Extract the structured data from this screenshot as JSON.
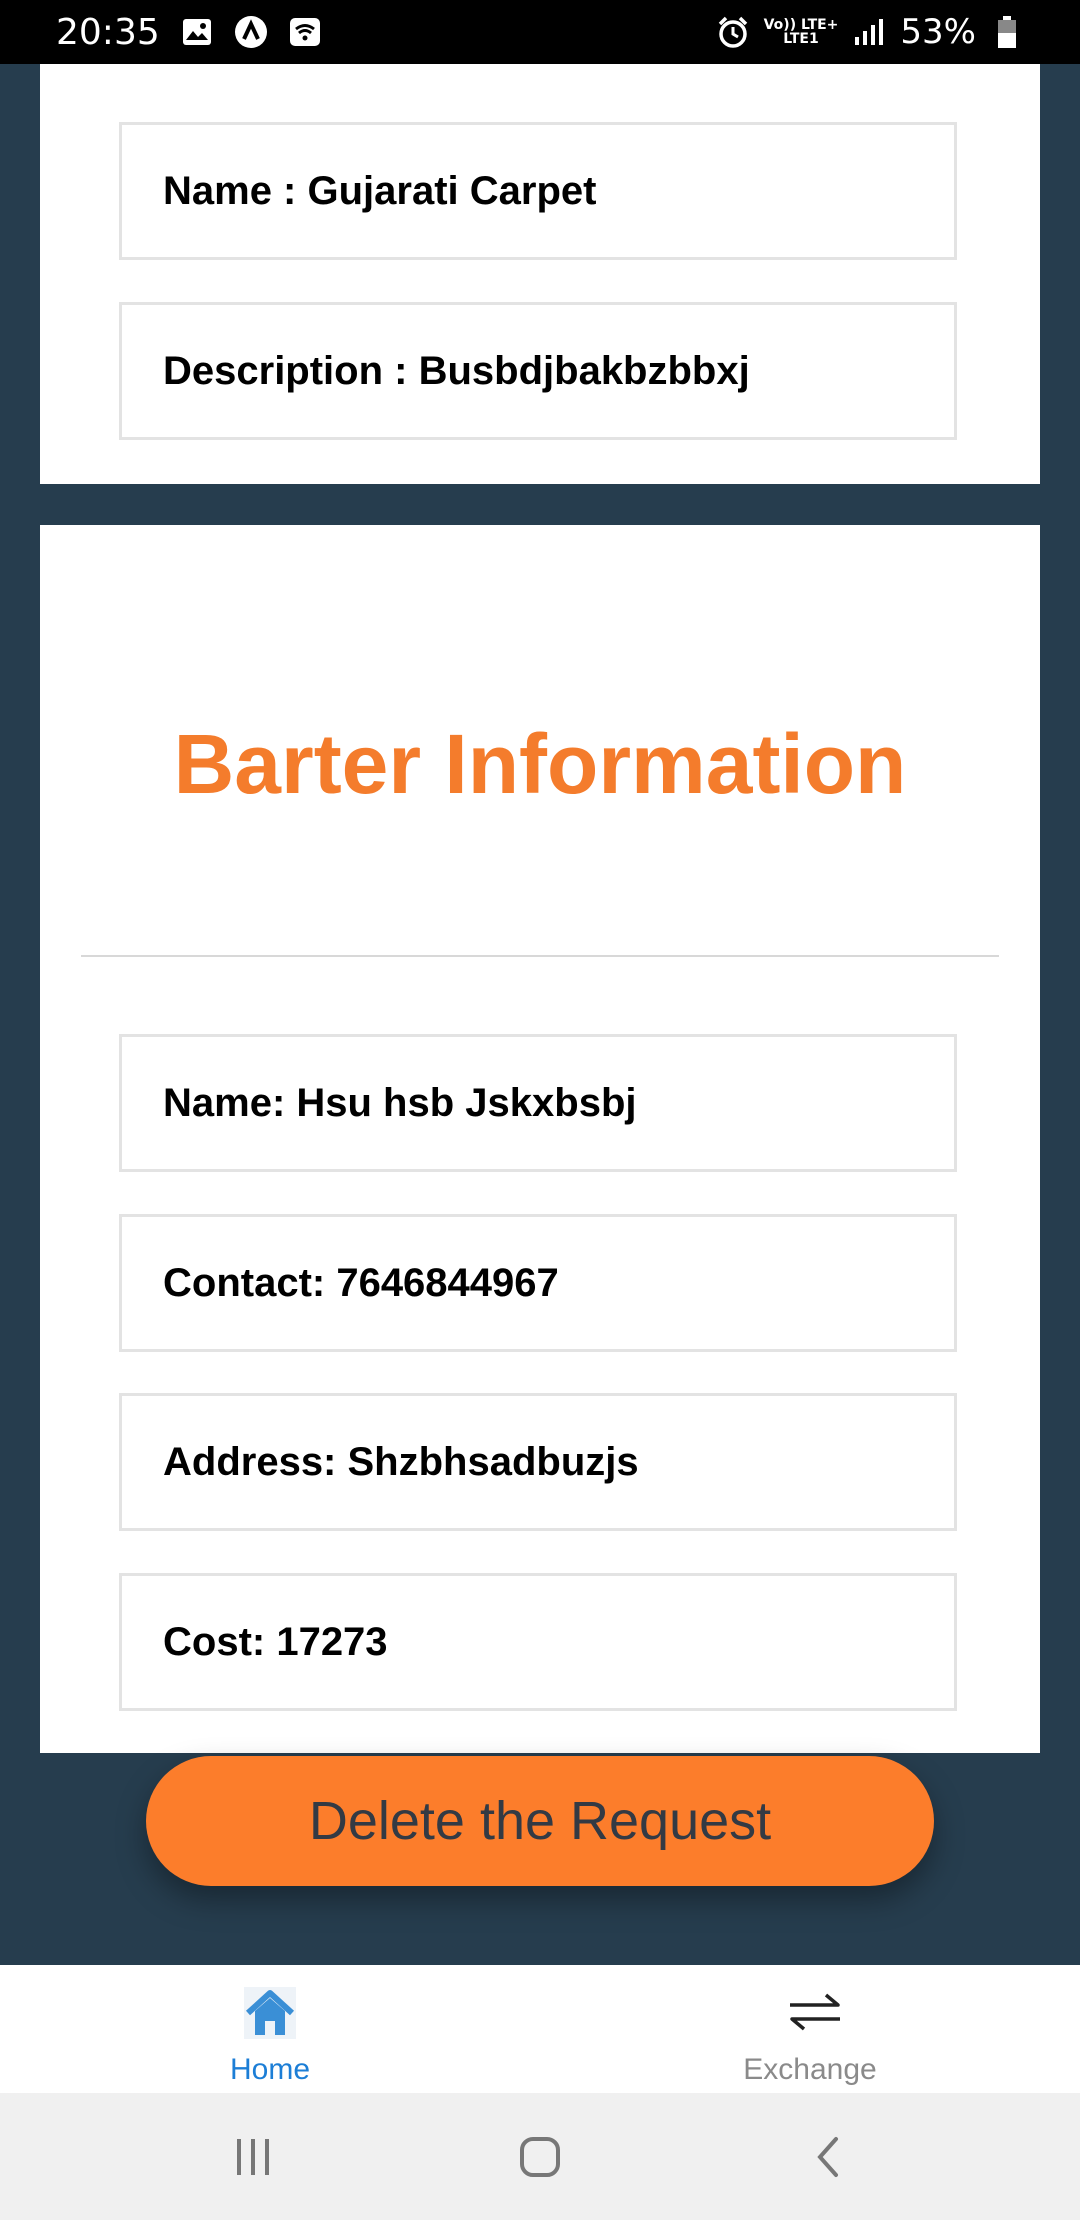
{
  "status_bar": {
    "time": "20:35",
    "network": "Vo)) LTE+",
    "network_sub": "LTE1",
    "battery": "53%"
  },
  "item": {
    "name": "Name : Gujarati Carpet",
    "description": "Description : Busbdjbakbzbbxj"
  },
  "barter": {
    "title": "Barter Information",
    "name": "Name: Hsu hsb Jskxbsbj",
    "contact": "Contact: 7646844967",
    "address": "Address: Shzbhsadbuzjs",
    "cost": "Cost: 17273"
  },
  "actions": {
    "delete_label": "Delete the Request"
  },
  "tabs": [
    {
      "label": "Home",
      "icon": "home-icon",
      "active": true
    },
    {
      "label": "Exchange",
      "icon": "exchange-icon",
      "active": false
    }
  ],
  "colors": {
    "background": "#263d4e",
    "accent": "#f47c2c",
    "button": "#fc7d2b",
    "active_tab": "#1c7ed6"
  }
}
